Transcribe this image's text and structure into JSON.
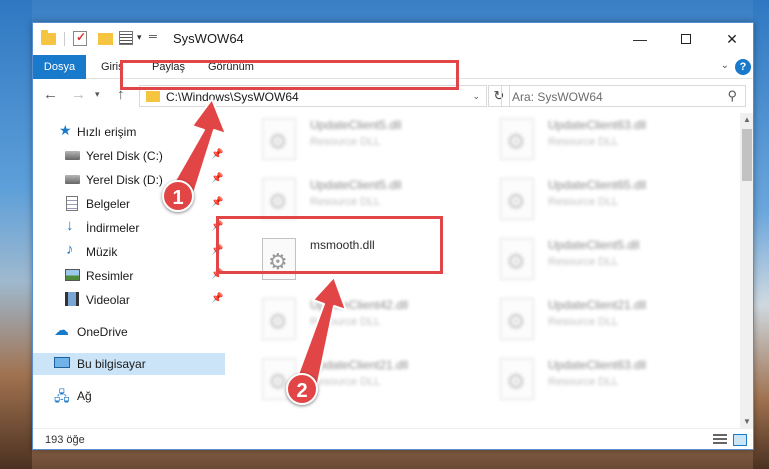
{
  "window": {
    "title": "SysWOW64",
    "controls": {
      "minimize": "—",
      "maximize": "",
      "close": "✕"
    }
  },
  "ribbon": {
    "tabs": [
      "Dosya",
      "Giriş",
      "Paylaş",
      "Görünüm"
    ],
    "help": "?"
  },
  "address": {
    "path": "C:\\Windows\\SysWOW64",
    "search_placeholder": "Ara: SysWOW64"
  },
  "navpane": {
    "items": [
      {
        "label": "Hızlı erişim",
        "icon": "star-icon"
      },
      {
        "label": "Yerel Disk (C:)",
        "icon": "disk-icon",
        "pinned": true
      },
      {
        "label": "Yerel Disk (D:)",
        "icon": "disk-icon",
        "pinned": true
      },
      {
        "label": "Belgeler",
        "icon": "document-icon",
        "pinned": true
      },
      {
        "label": "İndirmeler",
        "icon": "download-icon",
        "pinned": true
      },
      {
        "label": "Müzik",
        "icon": "music-icon",
        "pinned": true
      },
      {
        "label": "Resimler",
        "icon": "pictures-icon",
        "pinned": true
      },
      {
        "label": "Videolar",
        "icon": "video-icon",
        "pinned": true
      },
      {
        "label": "OneDrive",
        "icon": "cloud-icon"
      },
      {
        "label": "Bu bilgisayar",
        "icon": "computer-icon",
        "selected": true
      },
      {
        "label": "Ağ",
        "icon": "network-icon"
      }
    ]
  },
  "files": [
    {
      "name": "UpdateClient5.dll",
      "desc": "Resource DLL",
      "blurred": true
    },
    {
      "name": "UpdateClient63.dll",
      "desc": "Resource DLL",
      "blurred": true
    },
    {
      "name": "UpdateClient5.dll",
      "desc": "Resource DLL",
      "blurred": true
    },
    {
      "name": "UpdateClient65.dll",
      "desc": "Resource DLL",
      "blurred": true
    },
    {
      "name": "msmooth.dll",
      "desc": "",
      "blurred": false
    },
    {
      "name": "UpdateClient5.dll",
      "desc": "Resource DLL",
      "blurred": true
    },
    {
      "name": "UpdateClient42.dll",
      "desc": "Resource DLL",
      "blurred": true
    },
    {
      "name": "UpdateClient21.dll",
      "desc": "Resource DLL",
      "blurred": true
    },
    {
      "name": "UpdateClient21.dll",
      "desc": "Resource DLL",
      "blurred": true
    },
    {
      "name": "UpdateClient63.dll",
      "desc": "Resource DLL",
      "blurred": true
    }
  ],
  "status": {
    "count": "193 öğe"
  },
  "annotations": {
    "step1": "1",
    "step2": "2",
    "color": "#e24545"
  }
}
